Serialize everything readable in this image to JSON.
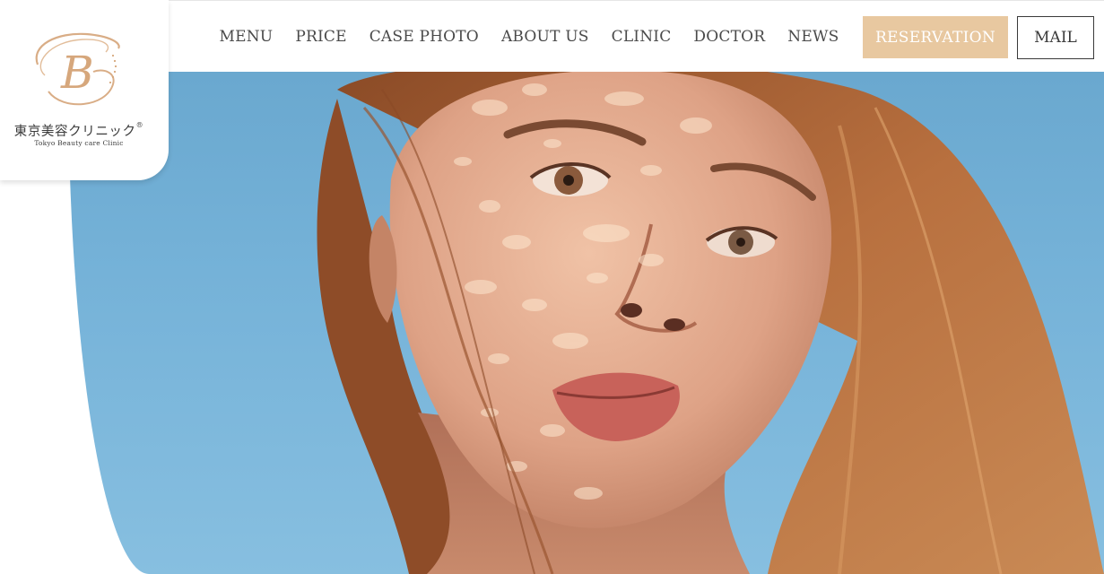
{
  "logo": {
    "monogram": "B",
    "japanese_name": "東京美容クリニック",
    "registered_mark": "®",
    "english_name": "Tokyo Beauty care Clinic"
  },
  "nav": {
    "items": [
      {
        "label": "MENU"
      },
      {
        "label": "PRICE"
      },
      {
        "label": "CASE PHOTO"
      },
      {
        "label": "ABOUT US"
      },
      {
        "label": "CLINIC"
      },
      {
        "label": "DOCTOR"
      },
      {
        "label": "NEWS"
      }
    ]
  },
  "actions": {
    "reservation_label": "RESERVATION",
    "mail_label": "MAIL"
  },
  "hero": {
    "image": "woman-portrait-dappled-light"
  },
  "colors": {
    "accent_gold": "#e8c8a0",
    "logo_gold": "#d6a77c",
    "nav_text": "#4a4a4a",
    "sky": "#75b2d8",
    "hair": "#b06a3c",
    "skin": "#e2a88a"
  }
}
